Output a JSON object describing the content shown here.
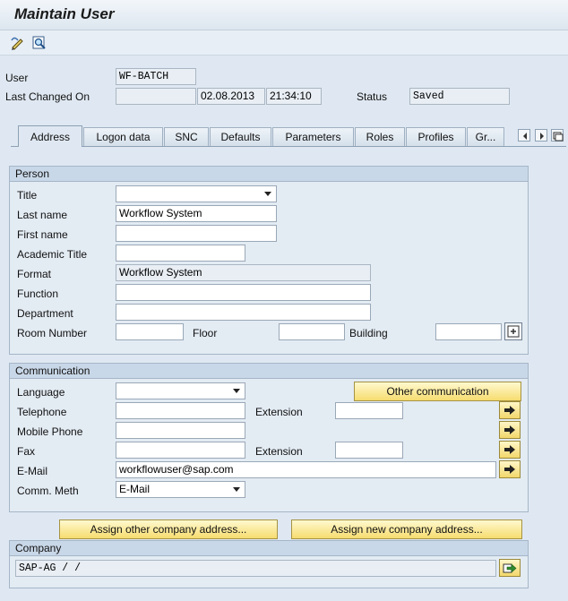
{
  "window": {
    "title": "Maintain User"
  },
  "toolbar": {
    "items": [
      {
        "icon": "edit-pencil-icon"
      },
      {
        "icon": "search-display-icon"
      }
    ]
  },
  "header": {
    "user_label": "User",
    "user_value": "WF-BATCH",
    "last_changed_label": "Last Changed On",
    "last_changed_by": "",
    "last_changed_date": "02.08.2013",
    "last_changed_time": "21:34:10",
    "status_label": "Status",
    "status_value": "Saved"
  },
  "tabs": [
    {
      "label": "Address",
      "active": true
    },
    {
      "label": "Logon data"
    },
    {
      "label": "SNC"
    },
    {
      "label": "Defaults"
    },
    {
      "label": "Parameters"
    },
    {
      "label": "Roles"
    },
    {
      "label": "Profiles"
    },
    {
      "label": "Gr..."
    }
  ],
  "person": {
    "heading": "Person",
    "title_label": "Title",
    "title_value": "",
    "last_name_label": "Last name",
    "last_name_value": "Workflow System",
    "first_name_label": "First name",
    "first_name_value": "",
    "academic_title_label": "Academic Title",
    "academic_title_value": "",
    "format_label": "Format",
    "format_value": "Workflow System",
    "function_label": "Function",
    "function_value": "",
    "department_label": "Department",
    "department_value": "",
    "room_label": "Room Number",
    "room_value": "",
    "floor_label": "Floor",
    "floor_value": "",
    "building_label": "Building",
    "building_value": ""
  },
  "communication": {
    "heading": "Communication",
    "language_label": "Language",
    "language_value": "",
    "other_comm_button": "Other communication",
    "telephone_label": "Telephone",
    "telephone_value": "",
    "extension_label": "Extension",
    "extension_value": "",
    "mobile_label": "Mobile Phone",
    "mobile_value": "",
    "fax_label": "Fax",
    "fax_value": "",
    "fax_extension_label": "Extension",
    "fax_extension_value": "",
    "email_label": "E-Mail",
    "email_value": "workflowuser@sap.com",
    "comm_meth_label": "Comm. Meth",
    "comm_meth_value": "E-Mail"
  },
  "buttons": {
    "assign_other": "Assign other company address...",
    "assign_new": "Assign new company address..."
  },
  "company": {
    "heading": "Company",
    "value": "SAP-AG / /"
  }
}
